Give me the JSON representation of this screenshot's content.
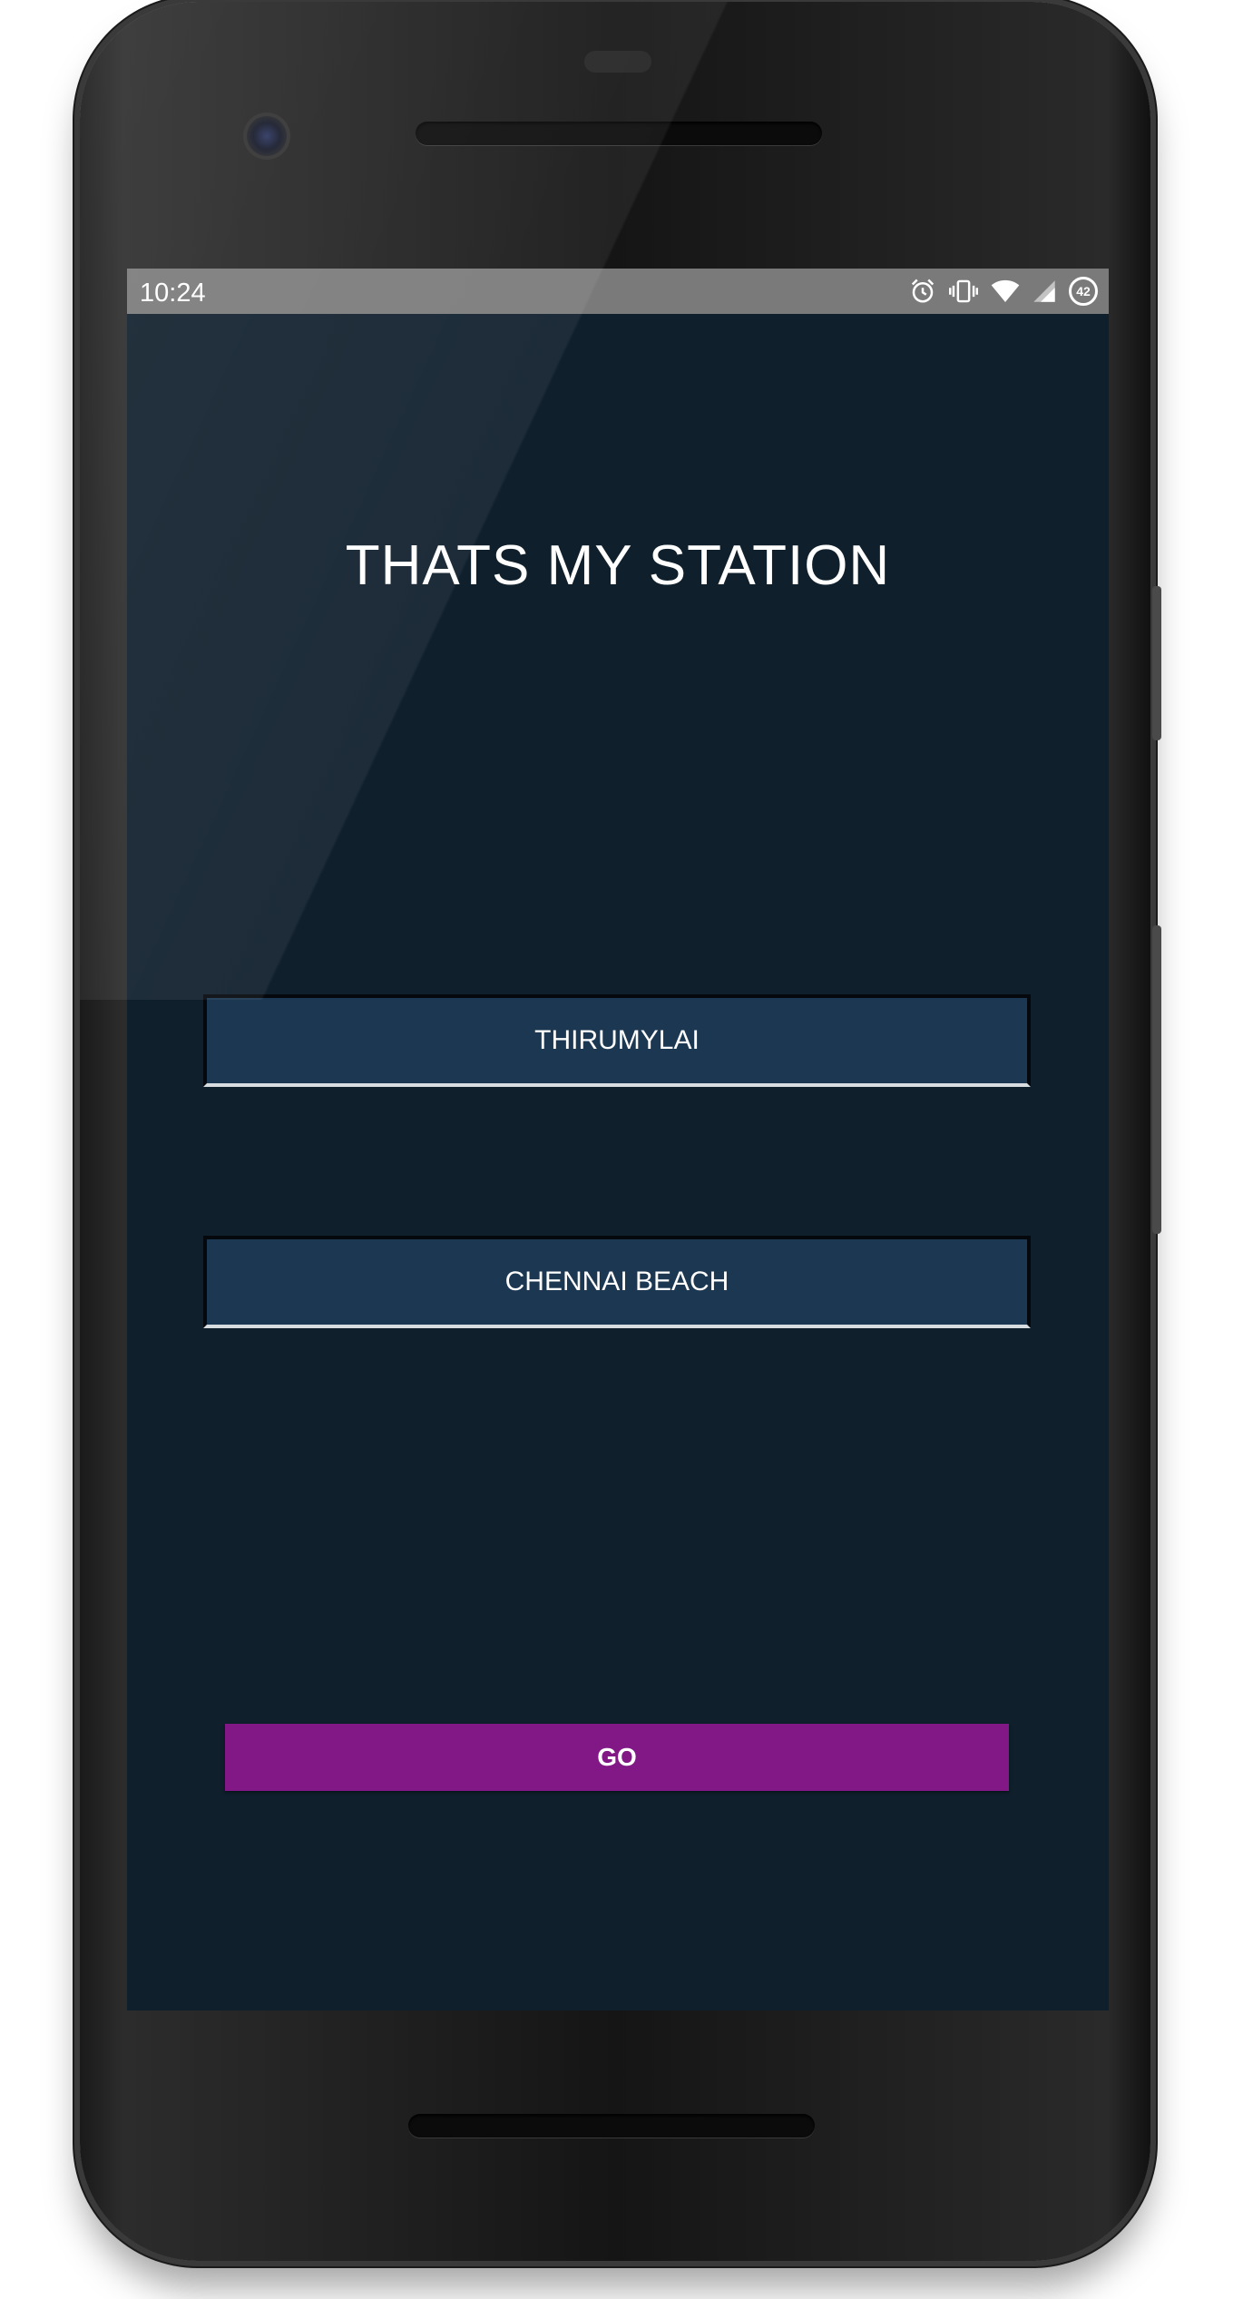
{
  "status_bar": {
    "time": "10:24",
    "battery_level": "42",
    "icons": [
      "alarm-icon",
      "vibrate-icon",
      "wifi-icon",
      "cell-signal-icon",
      "battery-icon"
    ]
  },
  "app": {
    "title": "THATS MY STATION",
    "from_station": "THIRUMYLAI",
    "to_station": "CHENNAI BEACH",
    "go_label": "GO"
  },
  "colors": {
    "background": "#0f1f2c",
    "field_background": "#1b3751",
    "go_button": "#821885",
    "status_bar": "#7a7a7a",
    "text": "#ffffff"
  }
}
